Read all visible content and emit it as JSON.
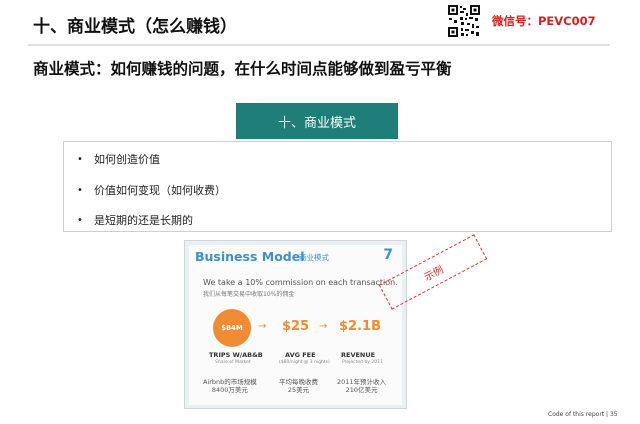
{
  "header": {
    "title": "十、商业模式（怎么赚钱）",
    "wechat": "微信号：PEVC007"
  },
  "subtitle": "商业模式：如何赚钱的问题，在什么时间点能够做到盈亏平衡",
  "section_box": "十、商业模式",
  "bullets": [
    "如何创造价值",
    "价值如何变现（如何收费）",
    "是短期的还是长期的"
  ],
  "example_slide": {
    "title": "Business Model",
    "subtitle_cn": "商业模式",
    "page_no": "7",
    "line_en": "We take a 10% commission on each transaction.",
    "line_cn": "我们从每笔交易中收取10%的佣金",
    "circle_value": "$84M",
    "avg_fee_value": "$25",
    "revenue_value": "$2.1B",
    "trips_label": "TRIPS W/AB&B",
    "trips_sub": "Share of Market",
    "avg_fee_label": "AVG FEE",
    "avg_fee_sub": "($80/night @ 3 nights)",
    "revenue_label": "REVENUE",
    "revenue_sub": "Projected by 2011",
    "note1": "Airbnb的市场规模\n8400万美元",
    "note2": "平均每晚收费\n25美元",
    "note3": "2011年预计收入\n210亿美元"
  },
  "stamp": "示例",
  "footer": "Code of this report  | 35",
  "colors": {
    "teal": "#1f7f78",
    "wechat_red": "#d2231e",
    "slide_blue": "#3c8fd2",
    "slide_orange": "#f08b33"
  }
}
